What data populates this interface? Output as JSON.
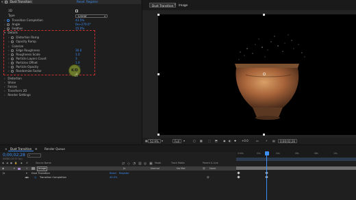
{
  "effect_controls": {
    "header": {
      "effect_name": "Dust Transition",
      "reset": "Reset",
      "register": "Register"
    },
    "rows": {
      "threed": {
        "label": "3D"
      },
      "type": {
        "label": "Type",
        "value": "Linear"
      },
      "transition_completion": {
        "label": "Transition Completion",
        "value": "43.5%"
      },
      "angle": {
        "label": "Angle",
        "value": "0x+270.0°"
      },
      "feather": {
        "label": "Feather",
        "value": "15.0%"
      },
      "details": {
        "label": "Details"
      },
      "distortion_ramp": {
        "label": "Distortion Ramp"
      },
      "opacity_ramp": {
        "label": "Opacity Ramp"
      },
      "colorize": {
        "label": "Colorize"
      },
      "edge_roughness": {
        "label": "Edge Roughness",
        "value": "30.0"
      },
      "roughness_scale": {
        "label": "Roughness Scale",
        "value": "1.0"
      },
      "particle_layers_count": {
        "label": "Particle Layers Count",
        "value": "3"
      },
      "particles_offset": {
        "label": "Particles Offset",
        "value": "1.0"
      },
      "particle_opacity": {
        "label": "Particle Opacity",
        "value": "1.0"
      },
      "randomize_factor": {
        "label": "Randomize Factor",
        "value": "0"
      },
      "distortion": {
        "label": "Distortion"
      },
      "shine": {
        "label": "Shine"
      },
      "forces": {
        "label": "Forces"
      },
      "transform_2d": {
        "label": "Transform 2D"
      },
      "render_settings": {
        "label": "Render Settings"
      }
    },
    "cursor_badge": "K/D"
  },
  "viewer": {
    "tabs": {
      "comp": "Dust Transition",
      "layer": "Image"
    },
    "bottom_bar": {
      "zoom": "52.9%",
      "resolution": "Full",
      "exposure": "+0.0",
      "timecode": "0;00;02;28"
    }
  },
  "timeline": {
    "tabs": {
      "comp": "Dust Transition",
      "render_queue": "Render Queue"
    },
    "timecode": "0;00;02;28",
    "timecode_sub": "00088 (29.97 fps)",
    "columns": {
      "source_name": "Source Name",
      "mode": "Mode",
      "track_matte": "Track Matte",
      "parent_link": "Parent & Link"
    },
    "layers": {
      "layer1": {
        "index": "1",
        "name": "Image",
        "mode": "Normal",
        "matte": "No Mat",
        "parent": "None"
      },
      "effect": {
        "name": "Dust Transition",
        "reset": "Reset",
        "register": "Register"
      },
      "property": {
        "name": "Transition Completion",
        "value": "43.5%"
      }
    },
    "ruler": [
      "0:00s",
      "02s",
      "04s",
      "06s",
      "08s",
      "10s"
    ]
  },
  "colors": {
    "accent": "#3d8ef5",
    "panel_bg": "#1e1e1e",
    "canvas_bg": "#000000",
    "highlight_box": "#c93030"
  }
}
